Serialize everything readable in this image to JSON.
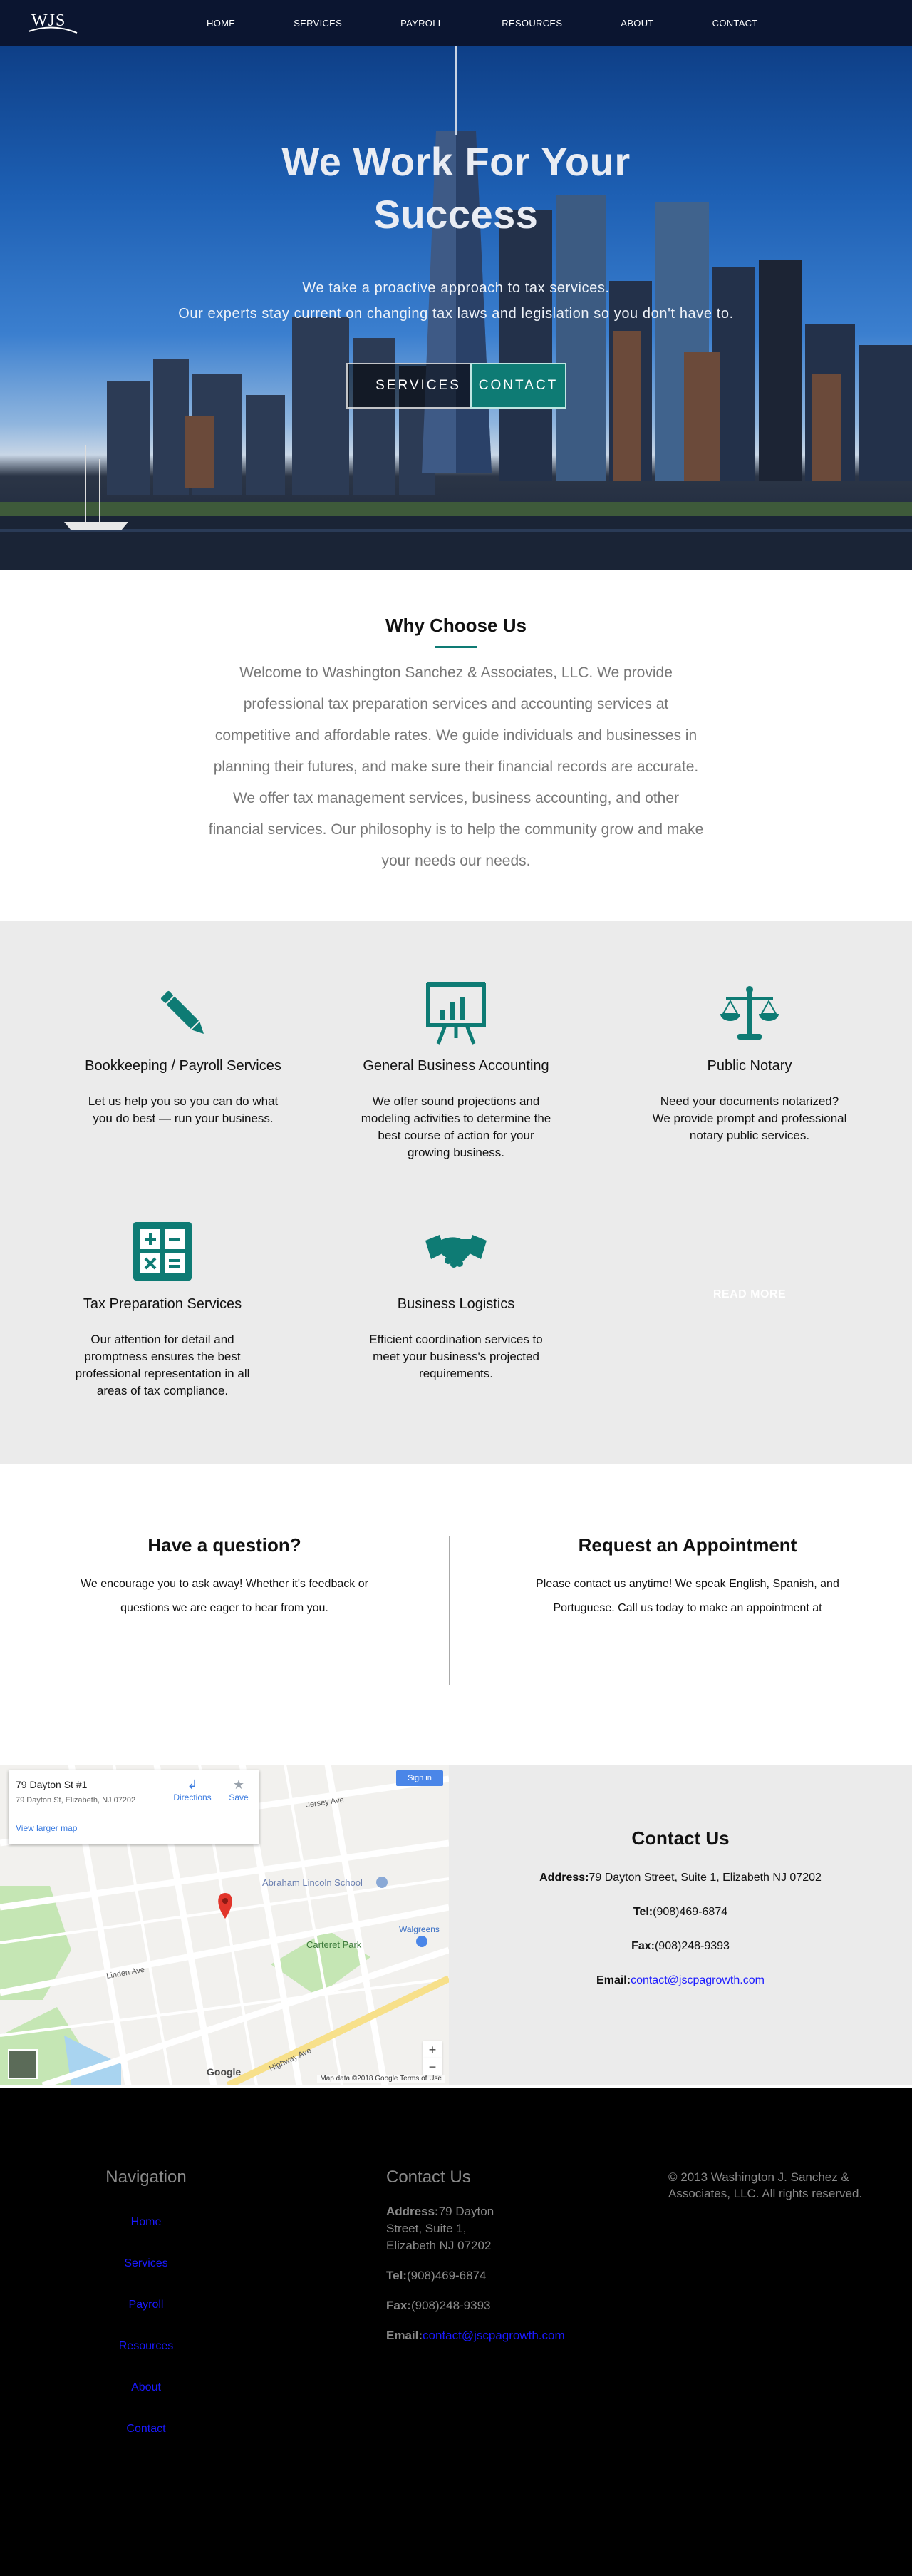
{
  "nav": {
    "logo_text": "WJS",
    "links": [
      "HOME",
      "SERVICES",
      "PAYROLL",
      "RESOURCES",
      "ABOUT",
      "CONTACT"
    ]
  },
  "hero": {
    "title_line1": "We Work For Your",
    "title_line2": "Success",
    "subtitle_line1": "We take a proactive approach to tax services.",
    "subtitle_line2": "Our experts stay current on changing tax laws and legislation so you don't have to.",
    "services_button": "SERVICES",
    "contact_button": "CONTACT"
  },
  "why": {
    "title": "Why Choose Us",
    "body": "Welcome to Washington Sanchez & Associates, LLC. We provide professional tax preparation services and accounting services at competitive and affordable rates. We guide individuals and businesses in planning their futures, and make sure their financial records are accurate. We offer tax management services, business accounting, and other financial services. Our philosophy is to help the community grow and make your needs our needs."
  },
  "services": {
    "items": [
      {
        "icon": "pencil-icon",
        "title": "Bookkeeping / Payroll Services",
        "desc": "Let us help you so you can do what you do best — run your business."
      },
      {
        "icon": "presentation-chart-icon",
        "title": "General Business Accounting",
        "desc": "We offer sound projections and modeling activities to determine the best course of action for your growing business."
      },
      {
        "icon": "scales-icon",
        "title": "Public Notary",
        "desc": "Need your documents notarized? We provide prompt and professional notary public services."
      },
      {
        "icon": "calculator-icon",
        "title": "Tax Preparation Services",
        "desc": "Our attention for detail and promptness ensures the best professional representation in all areas of tax compliance."
      },
      {
        "icon": "handshake-icon",
        "title": "Business Logistics",
        "desc": "Efficient coordination services to meet your business's projected requirements."
      }
    ],
    "read_more": "READ MORE"
  },
  "question": {
    "title": "Have a question?",
    "desc": "We encourage you to ask away! Whether it's feedback or questions we are eager to hear from you."
  },
  "appointment": {
    "title": "Request an Appointment",
    "desc": "Please contact us anytime! We speak English, Spanish, and Portuguese. Call us today to make an appointment at"
  },
  "map": {
    "place_title": "79 Dayton St #1",
    "place_address": "79 Dayton St, Elizabeth, NJ 07202",
    "view_larger": "View larger map",
    "directions": "Directions",
    "save": "Save",
    "sign_in": "Sign in",
    "zoom_in": "+",
    "zoom_out": "−",
    "footer": "Map data ©2018 Google   Terms of Use",
    "google": "Google",
    "labels": {
      "school": "Abraham Lincoln School",
      "park": "Carteret Park",
      "store": "Walgreens",
      "jersey": "Jersey Ave",
      "linden": "Linden Ave",
      "highway": "Highway Ave"
    }
  },
  "contact": {
    "title": "Contact Us",
    "address_label": "Address:",
    "address": "79 Dayton Street, Suite 1, Elizabeth NJ 07202",
    "tel_label": "Tel:",
    "tel": "(908)469-6874",
    "fax_label": "Fax:",
    "fax": "(908)248-9393",
    "email_label": "Email:",
    "email": "contact@jscpagrowth.com"
  },
  "footer": {
    "nav_title": "Navigation",
    "nav_links": [
      "Home",
      "Services",
      "Payroll",
      "Resources",
      "About",
      "Contact"
    ],
    "contact_title": "Contact Us",
    "address_label": "Address:",
    "address_part1": "79 Dayton",
    "address_part2": "Street, Suite 1,",
    "address_part3": "Elizabeth NJ 07202",
    "tel_label": "Tel:",
    "tel": "(908)469-6874",
    "fax_label": "Fax:",
    "fax": "(908)248-9393",
    "email_label": "Email:",
    "email": "contact@jscpagrowth.com",
    "copyright": "© 2013 Washington J. Sanchez & Associates, LLC. All rights reserved."
  },
  "colors": {
    "accent": "#0e7b74",
    "nav_bg": "#0b1530",
    "section_gray": "#ebebeb",
    "link_blue": "#1a1aff"
  }
}
